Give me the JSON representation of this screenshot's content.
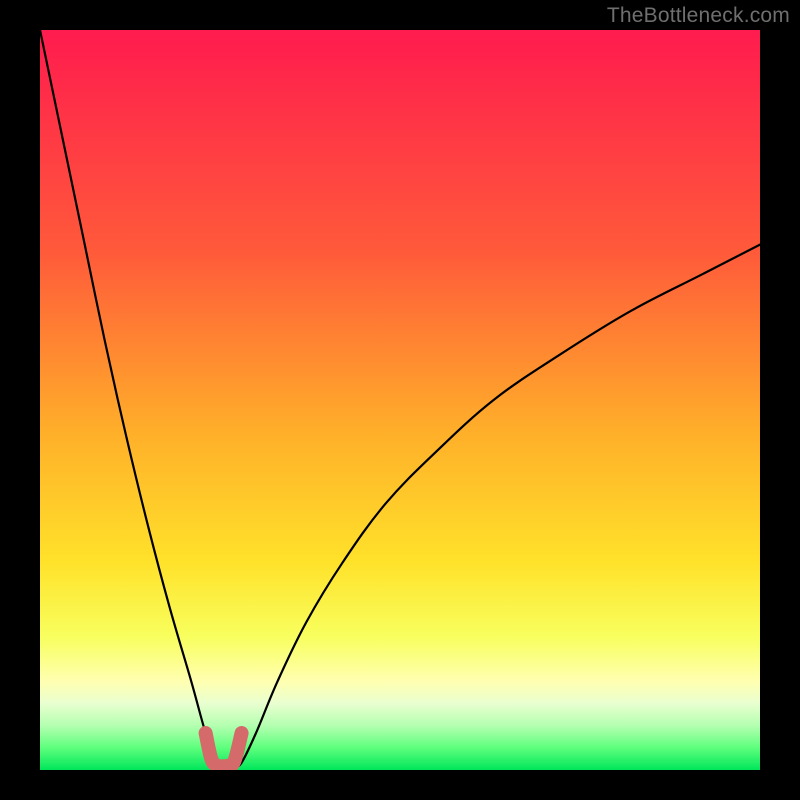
{
  "watermark": "TheBottleneck.com",
  "chart_data": {
    "type": "line",
    "title": "",
    "xlabel": "",
    "ylabel": "",
    "xlim": [
      0,
      100
    ],
    "ylim": [
      0,
      100
    ],
    "grid": false,
    "legend": false,
    "series": [
      {
        "name": "bottleneck-curve",
        "x": [
          0,
          3,
          6,
          9,
          12,
          15,
          18,
          21,
          23,
          24.5,
          26,
          27,
          28,
          30,
          33,
          37,
          42,
          48,
          55,
          63,
          72,
          82,
          92,
          100
        ],
        "y": [
          100,
          86,
          72,
          58,
          45,
          33,
          22,
          12,
          5,
          1,
          0.5,
          0.5,
          1,
          5,
          12,
          20,
          28,
          36,
          43,
          50,
          56,
          62,
          67,
          71
        ]
      },
      {
        "name": "optimal-range-marker",
        "x": [
          23,
          23.8,
          24.6,
          25.4,
          26.2,
          27,
          28
        ],
        "y": [
          5,
          1.5,
          0.6,
          0.5,
          0.6,
          1.2,
          5
        ]
      }
    ],
    "gradient_stops": [
      {
        "pct": 0,
        "color": "#ff1b4e"
      },
      {
        "pct": 30,
        "color": "#ff5a3a"
      },
      {
        "pct": 55,
        "color": "#ffb129"
      },
      {
        "pct": 72,
        "color": "#ffe22a"
      },
      {
        "pct": 82,
        "color": "#f8ff5e"
      },
      {
        "pct": 88,
        "color": "#ffffb0"
      },
      {
        "pct": 91,
        "color": "#e9ffd0"
      },
      {
        "pct": 94,
        "color": "#b4ffb0"
      },
      {
        "pct": 97,
        "color": "#5eff7d"
      },
      {
        "pct": 100,
        "color": "#00e65a"
      }
    ],
    "colors": {
      "curve": "#000000",
      "marker": "#d46a6a",
      "background_frame": "#000000"
    }
  }
}
